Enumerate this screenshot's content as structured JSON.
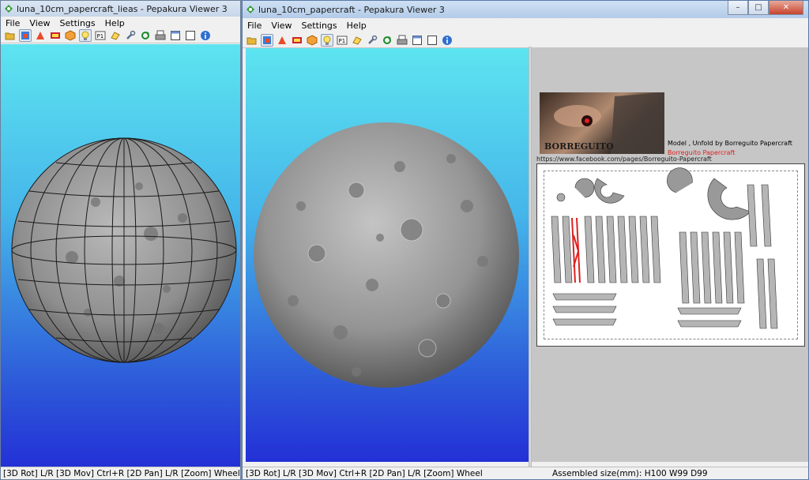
{
  "left_window": {
    "title": "luna_10cm_papercraft_lieas - Pepakura Viewer 3",
    "menu": [
      "File",
      "View",
      "Settings",
      "Help"
    ],
    "status": "[3D Rot] L/R [3D Mov] Ctrl+R [2D Pan] L/R [Zoom] Wheel"
  },
  "right_window": {
    "title": "luna_10cm_papercraft - Pepakura Viewer 3",
    "menu": [
      "File",
      "View",
      "Settings",
      "Help"
    ],
    "status_left": "[3D Rot] L/R [3D Mov] Ctrl+R [2D Pan] L/R [Zoom] Wheel",
    "status_right": "Assembled size(mm): H100 W99 D99",
    "controls": {
      "minimize": "–",
      "maximize": "□",
      "close": "✕"
    }
  },
  "paper": {
    "banner_text": "BORREGUITO",
    "credit_line": "Model , Unfold by Borreguito Papercraft",
    "credit_name": "Borreguito Papercraft",
    "credit_url": "https://www.facebook.com/pages/Borreguito-Papercraft"
  },
  "toolbar_icons": [
    "open-icon",
    "3d-view-icon",
    "paper-view-icon",
    "texture-icon",
    "cube-icon",
    "lightbulb-icon",
    "page-number-icon",
    "flap-icon",
    "wrench-icon",
    "rotate-icon",
    "print-icon",
    "window-icon",
    "window2-icon",
    "info-icon"
  ],
  "colors": {
    "sky_top": "#5de4f0",
    "sky_bottom": "#2330d6",
    "highlight_red": "#e02020"
  }
}
